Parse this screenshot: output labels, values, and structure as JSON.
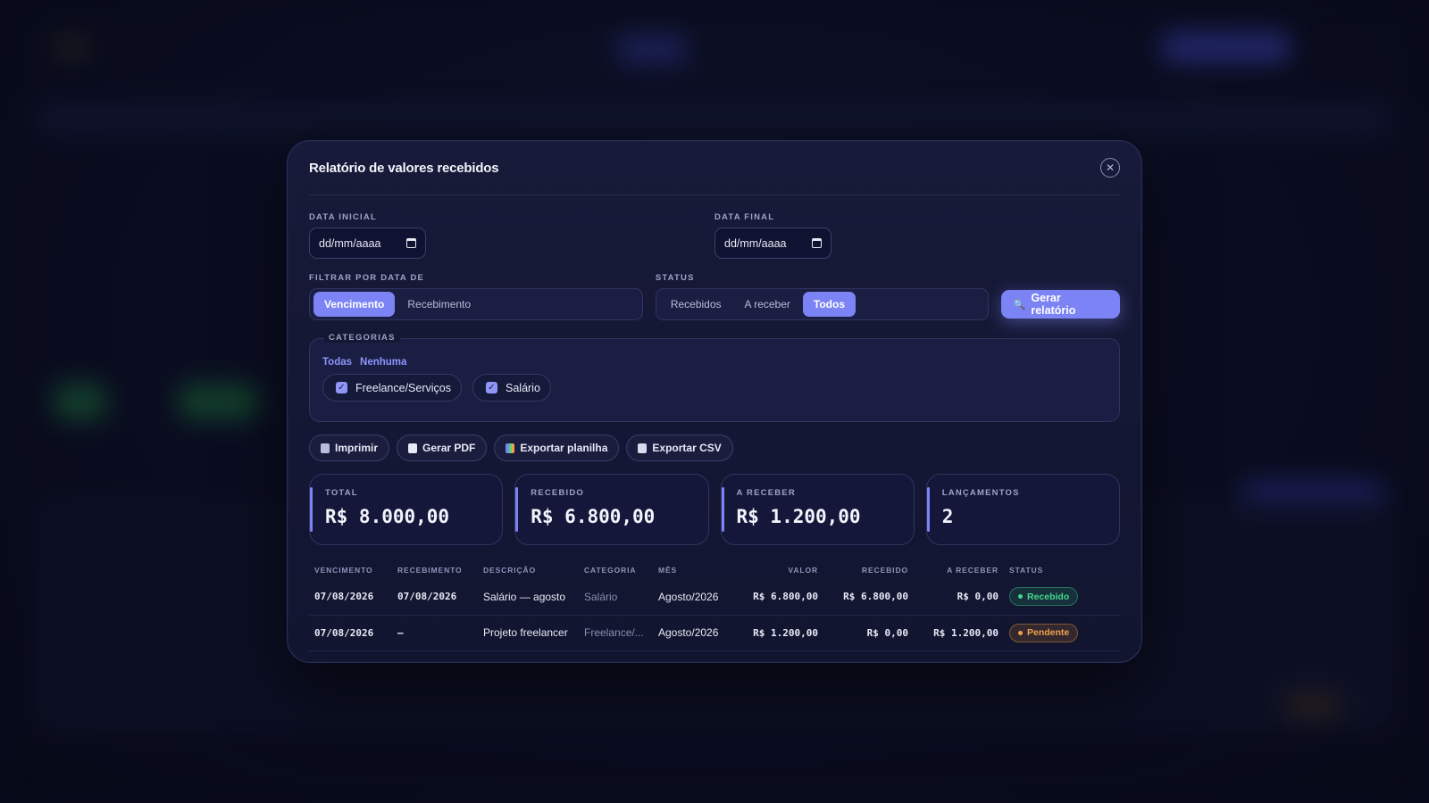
{
  "modal": {
    "title": "Relatório de valores recebidos",
    "close_icon": "close-icon"
  },
  "dates": {
    "start_label": "DATA INICIAL",
    "start_placeholder": "dd/mm/aaaa",
    "end_label": "DATA FINAL",
    "end_placeholder": "dd/mm/aaaa"
  },
  "filter_by": {
    "label": "FILTRAR POR DATA DE",
    "options": [
      "Vencimento",
      "Recebimento"
    ],
    "selected": "Vencimento"
  },
  "status": {
    "label": "STATUS",
    "options": [
      "Recebidos",
      "A receber",
      "Todos"
    ],
    "selected": "Todos"
  },
  "generate_button": "Gerar relatório",
  "categories": {
    "label": "CATEGORIAS",
    "all_link": "Todas",
    "none_link": "Nenhuma",
    "items": [
      {
        "label": "Freelance/Serviços",
        "checked": true
      },
      {
        "label": "Salário",
        "checked": true
      }
    ]
  },
  "actions": {
    "print": "Imprimir",
    "pdf": "Gerar PDF",
    "spreadsheet": "Exportar planilha",
    "csv": "Exportar CSV"
  },
  "stats": [
    {
      "label": "TOTAL",
      "value": "R$ 8.000,00"
    },
    {
      "label": "RECEBIDO",
      "value": "R$ 6.800,00"
    },
    {
      "label": "A RECEBER",
      "value": "R$ 1.200,00"
    },
    {
      "label": "LANÇAMENTOS",
      "value": "2"
    }
  ],
  "table": {
    "headers": [
      "VENCIMENTO",
      "RECEBIMENTO",
      "DESCRIÇÃO",
      "CATEGORIA",
      "MÊS",
      "VALOR",
      "RECEBIDO",
      "A RECEBER",
      "STATUS"
    ],
    "rows": [
      [
        "07/08/2026",
        "07/08/2026",
        "Salário — agosto",
        "Salário",
        "Agosto/2026",
        "R$ 6.800,00",
        "R$ 6.800,00",
        "R$ 0,00",
        "Recebido"
      ],
      [
        "07/08/2026",
        "—",
        "Projeto freelancer",
        "Freelance/...",
        "Agosto/2026",
        "R$ 1.200,00",
        "R$ 0,00",
        "R$ 1.200,00",
        "Pendente"
      ]
    ]
  },
  "colors": {
    "accent": "#7b83f5",
    "received": "#45d58c",
    "pending": "#f1a14e",
    "modal_bg": "#151833"
  }
}
